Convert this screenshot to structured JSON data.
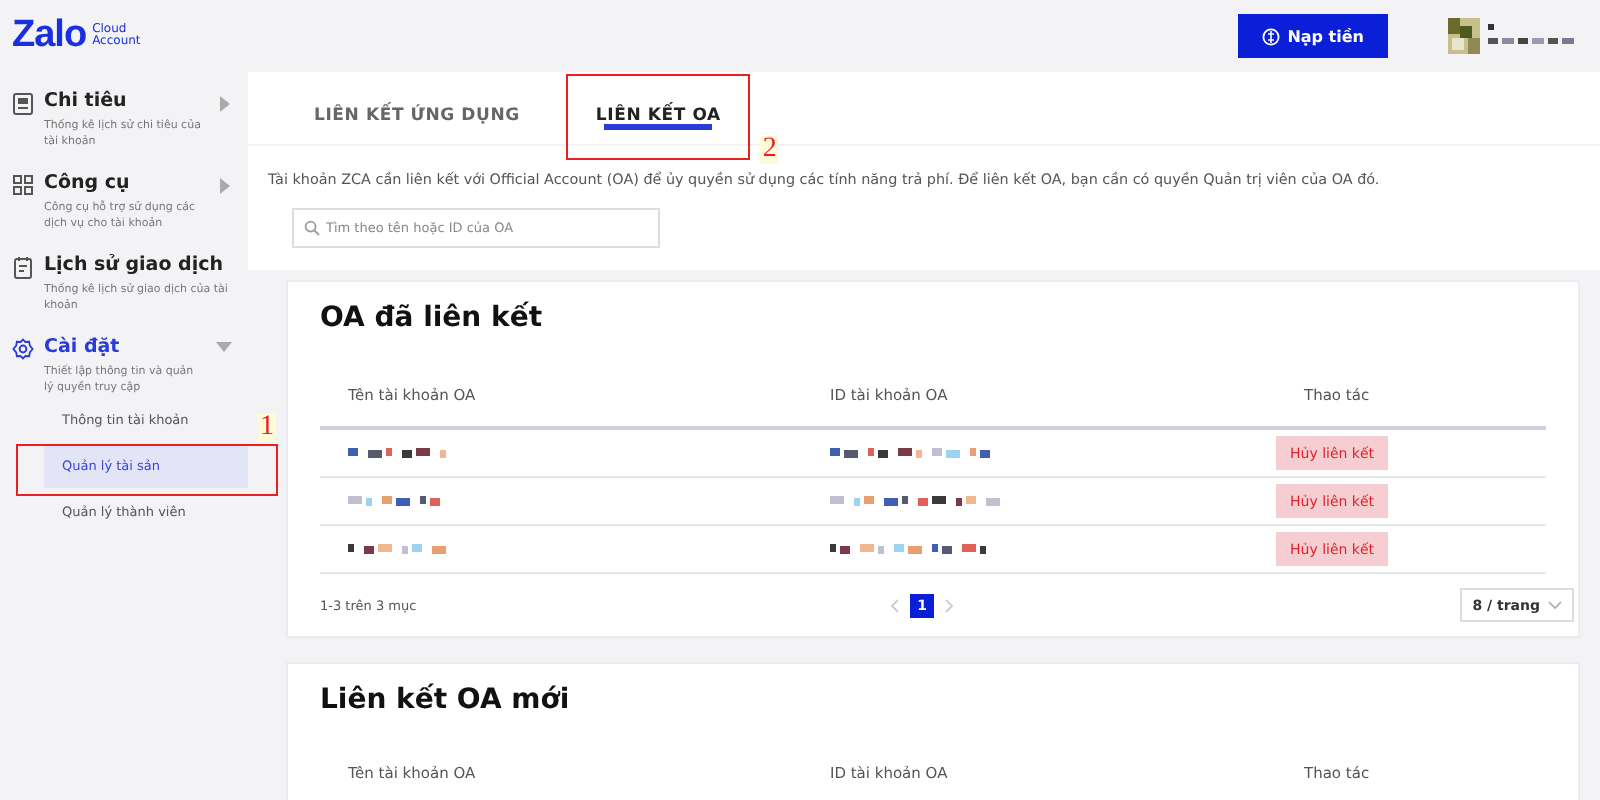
{
  "header": {
    "logo": "Zalo",
    "logo_subtitle": [
      "Cloud",
      "Account"
    ],
    "topup_button": "Nạp tiền"
  },
  "sidebar": {
    "items": [
      {
        "kind": "spending",
        "title": "Chi tiêu",
        "description": "Thống kê lịch sử chi tiêu của tài khoản",
        "expanded": false,
        "active": false
      },
      {
        "kind": "tools",
        "title": "Công cụ",
        "description": "Công cụ hỗ trợ sử dụng các dịch vụ cho tài khoản",
        "expanded": false,
        "active": false
      },
      {
        "kind": "history",
        "title": "Lịch sử giao dịch",
        "description": "Thống kê lịch sử giao dịch của tài khoản",
        "active": false
      },
      {
        "kind": "settings",
        "title": "Cài đặt",
        "description": "Thiết lập thông tin và quản lý quyền truy cập",
        "expanded": true,
        "active": true,
        "children": [
          {
            "label": "Thông tin tài khoản",
            "selected": false
          },
          {
            "label": "Quản lý tài sản",
            "selected": true,
            "callout": "1"
          },
          {
            "label": "Quản lý thành viên",
            "selected": false
          }
        ]
      }
    ]
  },
  "tabs": [
    {
      "label": "LIÊN KẾT ỨNG DỤNG",
      "selected": false
    },
    {
      "label": "LIÊN KẾT OA",
      "selected": true,
      "callout": "2"
    }
  ],
  "description": "Tài khoản ZCA cần liên kết với Official Account (OA) để ủy quyền sử dụng các tính năng trả phí. Để liên kết OA, bạn cần có quyền Quản trị viên của OA đó.",
  "search": {
    "placeholder": "Tìm theo tên hoặc ID của OA"
  },
  "linked_table": {
    "title": "OA đã liên kết",
    "columns": [
      "Tên tài khoản OA",
      "ID tài khoản OA",
      "Thao tác"
    ],
    "rows": [
      {
        "action": "Hủy liên kết"
      },
      {
        "action": "Hủy liên kết"
      },
      {
        "action": "Hủy liên kết"
      }
    ],
    "summary": "1-3 trên 3 mục",
    "pages": [
      {
        "label": "1",
        "selected": true
      }
    ],
    "page_size": "8 / trang"
  },
  "new_table": {
    "title": "Liên kết OA mới",
    "columns": [
      "Tên tài khoản OA",
      "ID tài khoản OA",
      "Thao tác"
    ]
  }
}
